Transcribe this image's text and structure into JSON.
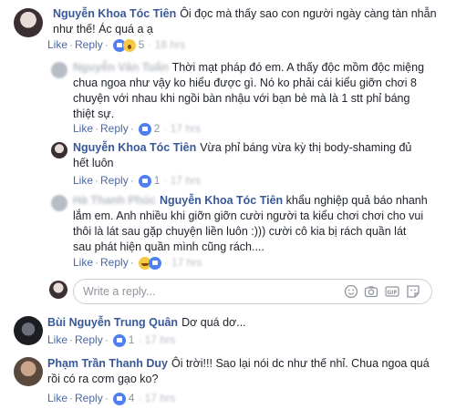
{
  "action_labels": {
    "like": "Like",
    "reply": "Reply"
  },
  "comments": [
    {
      "author": "Nguyễn Khoa Tóc Tiên",
      "text_line1": "Ôi đọc mà thấy sao con người ngày càng tàn nhẫn",
      "text_line2": "như thế! Ác quá a ạ",
      "reactions": [
        "like",
        "wow"
      ],
      "reaction_count": "5"
    },
    {
      "author": "",
      "text_line1": "Thời mạt pháp đó em. A thấy độc mồm độc miệng",
      "text_line2": "chua ngoa như vậy ko hiểu được gì. Nó ko phải cái kiểu giỡn chơi 8",
      "text_line3": "chuyện với nhau khi ngồi bàn nhậu với bạn bè mà là 1 stt phỉ báng",
      "text_line4": "thiệt sự.",
      "reactions": [
        "like"
      ],
      "reaction_count": "2"
    },
    {
      "author": "Nguyễn Khoa Tóc Tiên",
      "text_line1": "Vừa phỉ báng vừa kỳ thị body-shaming đủ",
      "text_line2": "hết luôn",
      "reactions": [
        "like"
      ],
      "reaction_count": "1"
    },
    {
      "author": "",
      "mention": "Nguyễn Khoa Tóc Tiên",
      "text_line1": "khẩu nghiệp quả báo nhanh",
      "text_line2": "lắm em. Anh nhiều khi giỡn giỡn cười người ta kiểu chơi chơi cho vui",
      "text_line3": "thôi là lát sau gặp chuyện liền luôn :))) cười cô kia bị rách quần lát",
      "text_line4": "sau phát hiện quần mình cũng rách....",
      "reactions": [
        "haha",
        "like"
      ],
      "reaction_count": ""
    },
    {
      "author": "Bùi Nguyễn Trung Quân",
      "text_line1": "Dơ quá dơ...",
      "reactions": [
        "like"
      ],
      "reaction_count": "1"
    },
    {
      "author": "Phạm Trần Thanh Duy",
      "text_line1": "Ôi trời!!! Sao lại nói dc như thế nhỉ. Chua ngoa quá",
      "text_line2": "rồi có ra cơm gạo ko?",
      "reactions": [
        "like"
      ],
      "reaction_count": "4"
    }
  ],
  "reply_box": {
    "placeholder": "Write a reply..."
  },
  "colors": {
    "link": "#385898",
    "meta": "#90949c",
    "reaction_like": "#4f7ff0",
    "reaction_emoji": "#f7c843"
  }
}
